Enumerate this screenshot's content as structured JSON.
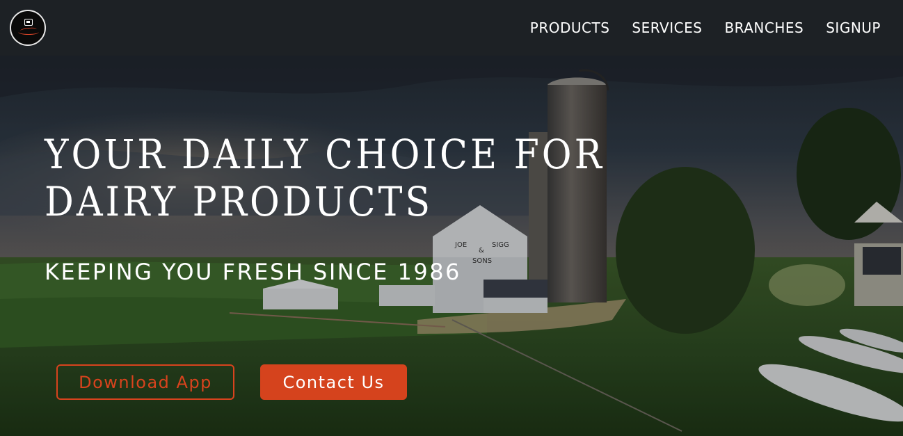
{
  "nav": {
    "logo_icon": "dairy-cup-logo-icon",
    "links": [
      "PRODUCTS",
      "SERVICES",
      "BRANCHES",
      "SIGNUP"
    ]
  },
  "hero": {
    "title": "YOUR DAILY CHOICE FOR DAIRY PRODUCTS",
    "subtitle": "KEEPING YOU FRESH SINCE 1986",
    "barn_sign": [
      "JOE",
      "SIGG",
      "&",
      "SONS"
    ],
    "background": "farm-barn-silo-photo"
  },
  "buttons": {
    "download_label": "Download App",
    "contact_label": "Contact Us"
  },
  "colors": {
    "accent": "#d5431d",
    "navbar": "#1d2125",
    "text": "#ffffff"
  }
}
